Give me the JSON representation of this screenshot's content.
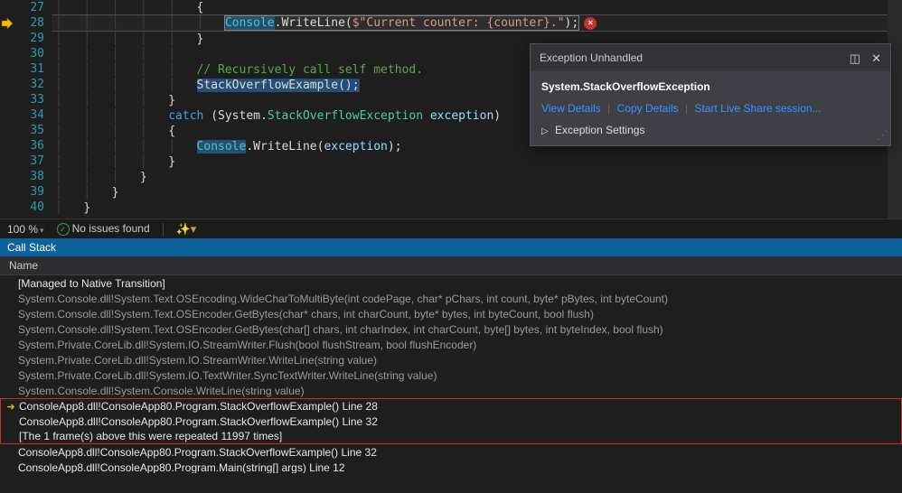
{
  "gutter_lines": [
    "27",
    "28",
    "29",
    "30",
    "31",
    "32",
    "33",
    "34",
    "35",
    "36",
    "37",
    "38",
    "39",
    "40"
  ],
  "code": {
    "l27": "{",
    "l28": {
      "cls": "Console",
      "method": ".WriteLine(",
      "str": "$\"Current counter: {counter}.\"",
      "close": ");"
    },
    "l29": "}",
    "l31": "// Recursively call self method.",
    "l32": {
      "method": "StackOverflowExample",
      "call": "();"
    },
    "l33": "}",
    "l34": {
      "kw": "catch",
      "open": " (",
      "ns": "System.",
      "type": "StackOverflowException",
      "sp": " ",
      "local": "exception",
      "close": ")"
    },
    "l35": "{",
    "l36": {
      "cls": "Console",
      "method": ".WriteLine(",
      "local": "exception",
      "close": ");"
    },
    "l37": "}",
    "l38": "}",
    "l39": "}",
    "l40": "}",
    "err_badge": "×"
  },
  "popup": {
    "title": "Exception Unhandled",
    "exception_type": "System.StackOverflowException",
    "links": [
      "View Details",
      "Copy Details",
      "Start Live Share session..."
    ],
    "settings_label": "Exception Settings",
    "link_sep": "|",
    "caret": "▷"
  },
  "status": {
    "zoom_label": "100 %",
    "issues_label": "No issues found",
    "dd": "▾",
    "wand": "✨▾",
    "check": "✓"
  },
  "callstack": {
    "panel_title": "Call Stack",
    "column_header": "Name",
    "rows": [
      {
        "text": "[Managed to Native Transition]",
        "bright": true
      },
      {
        "text": "System.Console.dll!System.Text.OSEncoding.WideCharToMultiByte(int codePage, char* pChars, int count, byte* pBytes, int byteCount)"
      },
      {
        "text": "System.Console.dll!System.Text.OSEncoder.GetBytes(char* chars, int charCount, byte* bytes, int byteCount, bool flush)"
      },
      {
        "text": "System.Console.dll!System.Text.OSEncoder.GetBytes(char[] chars, int charIndex, int charCount, byte[] bytes, int byteIndex, bool flush)"
      },
      {
        "text": "System.Private.CoreLib.dll!System.IO.StreamWriter.Flush(bool flushStream, bool flushEncoder)"
      },
      {
        "text": "System.Private.CoreLib.dll!System.IO.StreamWriter.WriteLine(string value)"
      },
      {
        "text": "System.Private.CoreLib.dll!System.IO.TextWriter.SyncTextWriter.WriteLine(string value)"
      },
      {
        "text": "System.Console.dll!System.Console.WriteLine(string value)"
      },
      {
        "text": "ConsoleApp8.dll!ConsoleApp80.Program.StackOverflowExample() Line 28",
        "bright": true,
        "arrow": true,
        "boxTop": true
      },
      {
        "text": "ConsoleApp8.dll!ConsoleApp80.Program.StackOverflowExample() Line 32",
        "bright": true,
        "boxMid": true
      },
      {
        "text": "[The 1 frame(s) above this were repeated 11997 times]",
        "bright": true,
        "boxBot": true
      },
      {
        "text": "ConsoleApp8.dll!ConsoleApp80.Program.StackOverflowExample() Line 32",
        "bright": true
      },
      {
        "text": "ConsoleApp8.dll!ConsoleApp80.Program.Main(string[] args) Line 12",
        "bright": true
      }
    ]
  }
}
